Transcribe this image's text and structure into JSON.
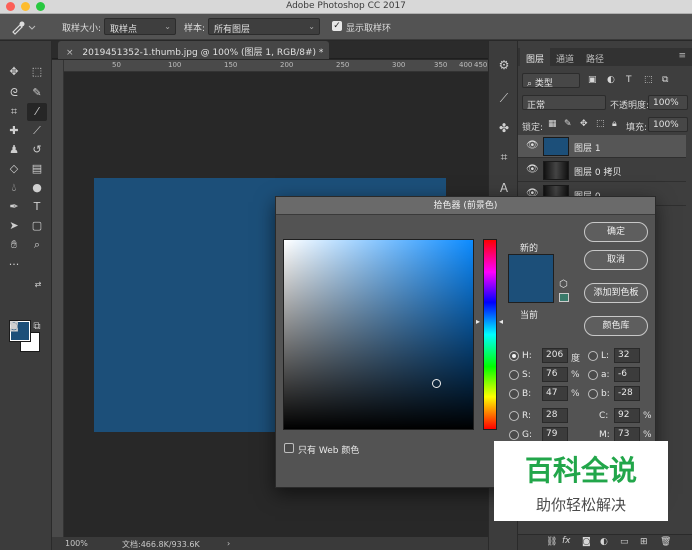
{
  "titlebar": {
    "title": "Adobe Photoshop CC 2017"
  },
  "options_bar": {
    "tool_icon": "eyedropper-icon",
    "sample_size_label": "取样大小:",
    "sample_size_value": "取样点",
    "sample_label": "样本:",
    "sample_value": "所有图层",
    "show_ring_label": "显示取样环",
    "show_ring_checked": true
  },
  "document": {
    "tab_title": "2019451352-1.thumb.jpg @ 100% (图层 1, RGB/8#) *",
    "close_icon": "close-icon",
    "fill_color": "#1c4f79",
    "ruler_marks": [
      "50",
      "100",
      "150",
      "200",
      "250",
      "300",
      "350",
      "400",
      "450"
    ]
  },
  "status_bar": {
    "zoom": "100%",
    "doc_info": "文档:466.8K/933.6K"
  },
  "toolbar": {
    "foreground_color": "#1c4f79",
    "background_color": "#ffffff",
    "tools": [
      "move-icon",
      "marquee-icon",
      "lasso-icon",
      "quick-select-icon",
      "crop-icon",
      "eyedropper-icon",
      "healing-icon",
      "brush-icon",
      "stamp-icon",
      "history-brush-icon",
      "eraser-icon",
      "gradient-icon",
      "blur-icon",
      "dodge-icon",
      "pen-icon",
      "type-icon",
      "path-select-icon",
      "shape-icon",
      "hand-icon",
      "zoom-icon",
      "more-icon"
    ]
  },
  "layers_panel": {
    "tabs": [
      "图层",
      "通道",
      "路径"
    ],
    "filter_value": "类型",
    "blend_mode": "正常",
    "opacity_label": "不透明度:",
    "opacity_value": "100%",
    "lock_label": "锁定:",
    "fill_label": "填充:",
    "fill_value": "100%",
    "layers": [
      {
        "name": "图层 1",
        "thumb_color": "#1c4f79",
        "selected": true
      },
      {
        "name": "图层 0 拷贝",
        "thumb_color": "#1a1a1a",
        "selected": false
      },
      {
        "name": "图层 0",
        "thumb_color": "#1a1a1a",
        "selected": false
      }
    ],
    "footer_icons": [
      "link-icon",
      "fx-icon",
      "mask-icon",
      "adjustment-icon",
      "folder-icon",
      "new-layer-icon",
      "trash-icon"
    ],
    "footer_fx": "fx"
  },
  "color_picker": {
    "title": "拾色器 (前景色)",
    "new_label": "新的",
    "current_label": "当前",
    "current_color": "#1c4f79",
    "ok_button": "确定",
    "cancel_button": "取消",
    "add_swatch_button": "添加到色板",
    "color_library_button": "颜色库",
    "web_only_label": "只有 Web 颜色",
    "hsb": {
      "H": "206",
      "S": "76",
      "B": "47",
      "h_unit": "度",
      "s_unit": "%",
      "b_unit": "%"
    },
    "lab": {
      "L": "32",
      "a": "-6",
      "b": "-28"
    },
    "rgb": {
      "R": "28",
      "G": "79"
    },
    "cmyk": {
      "C": "92",
      "M": "73",
      "c_unit": "%",
      "m_unit": "%"
    },
    "labels": {
      "H": "H:",
      "S": "S:",
      "B": "B:",
      "R": "R:",
      "G": "G:",
      "L": "L:",
      "a": "a:",
      "b": "b:",
      "C": "C:",
      "M": "M:"
    }
  },
  "watermark": {
    "title": "百科全说",
    "subtitle": "助你轻松解决"
  }
}
